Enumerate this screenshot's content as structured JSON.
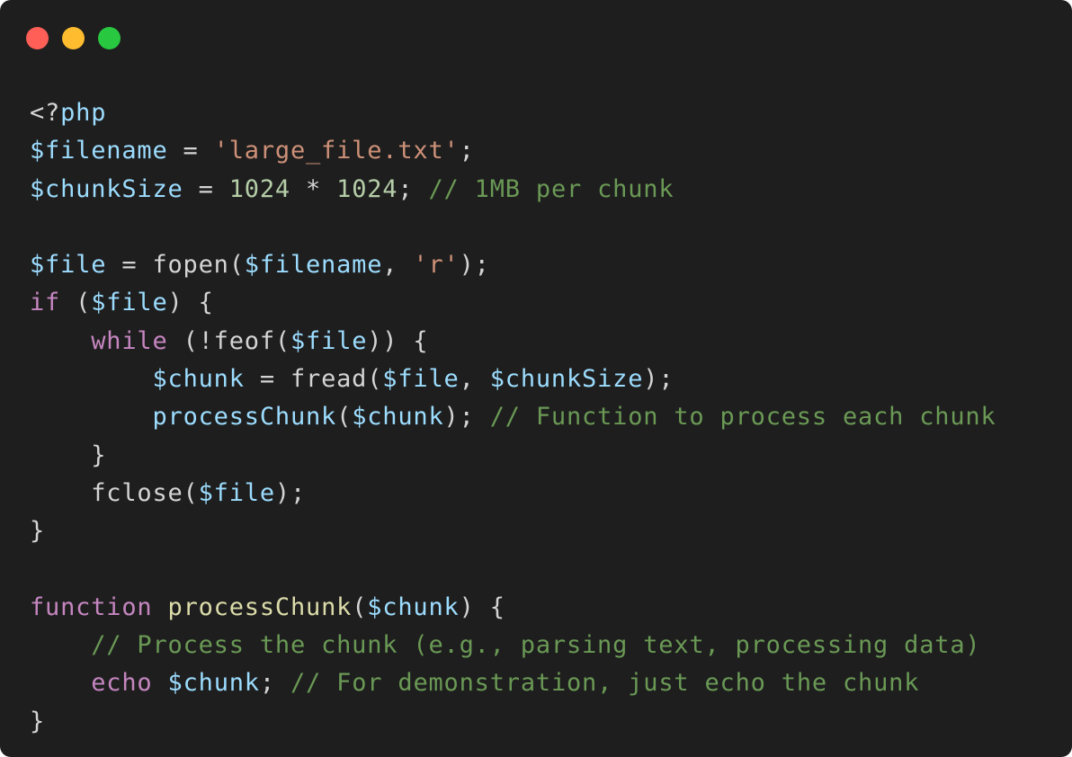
{
  "window": {
    "controls": [
      {
        "name": "close",
        "color": "#ff5f57"
      },
      {
        "name": "minimize",
        "color": "#febc2e"
      },
      {
        "name": "maximize",
        "color": "#28c840"
      }
    ]
  },
  "code": {
    "language": "php",
    "lines": [
      [
        {
          "t": "plain",
          "v": "<?"
        },
        {
          "t": "var",
          "v": "php"
        }
      ],
      [
        {
          "t": "var",
          "v": "$filename"
        },
        {
          "t": "plain",
          "v": " = "
        },
        {
          "t": "str",
          "v": "'large_file.txt'"
        },
        {
          "t": "plain",
          "v": ";"
        }
      ],
      [
        {
          "t": "var",
          "v": "$chunkSize"
        },
        {
          "t": "plain",
          "v": " = "
        },
        {
          "t": "num",
          "v": "1024"
        },
        {
          "t": "plain",
          "v": " * "
        },
        {
          "t": "num",
          "v": "1024"
        },
        {
          "t": "plain",
          "v": "; "
        },
        {
          "t": "cmt",
          "v": "// 1MB per chunk"
        }
      ],
      [],
      [
        {
          "t": "var",
          "v": "$file"
        },
        {
          "t": "plain",
          "v": " = fopen("
        },
        {
          "t": "var",
          "v": "$filename"
        },
        {
          "t": "plain",
          "v": ", "
        },
        {
          "t": "str",
          "v": "'r'"
        },
        {
          "t": "plain",
          "v": ");"
        }
      ],
      [
        {
          "t": "kw",
          "v": "if"
        },
        {
          "t": "plain",
          "v": " ("
        },
        {
          "t": "var",
          "v": "$file"
        },
        {
          "t": "plain",
          "v": ") {"
        }
      ],
      [
        {
          "t": "plain",
          "v": "    "
        },
        {
          "t": "kw",
          "v": "while"
        },
        {
          "t": "plain",
          "v": " (!feof("
        },
        {
          "t": "var",
          "v": "$file"
        },
        {
          "t": "plain",
          "v": ")) {"
        }
      ],
      [
        {
          "t": "plain",
          "v": "        "
        },
        {
          "t": "var",
          "v": "$chunk"
        },
        {
          "t": "plain",
          "v": " = fread("
        },
        {
          "t": "var",
          "v": "$file"
        },
        {
          "t": "plain",
          "v": ", "
        },
        {
          "t": "var",
          "v": "$chunkSize"
        },
        {
          "t": "plain",
          "v": ");"
        }
      ],
      [
        {
          "t": "plain",
          "v": "        "
        },
        {
          "t": "var",
          "v": "processChunk"
        },
        {
          "t": "plain",
          "v": "("
        },
        {
          "t": "var",
          "v": "$chunk"
        },
        {
          "t": "plain",
          "v": "); "
        },
        {
          "t": "cmt",
          "v": "// Function to process each chunk"
        }
      ],
      [
        {
          "t": "plain",
          "v": "    }"
        }
      ],
      [
        {
          "t": "plain",
          "v": "    fclose("
        },
        {
          "t": "var",
          "v": "$file"
        },
        {
          "t": "plain",
          "v": ");"
        }
      ],
      [
        {
          "t": "plain",
          "v": "}"
        }
      ],
      [],
      [
        {
          "t": "kw",
          "v": "function"
        },
        {
          "t": "plain",
          "v": " "
        },
        {
          "t": "fn",
          "v": "processChunk"
        },
        {
          "t": "plain",
          "v": "("
        },
        {
          "t": "var",
          "v": "$chunk"
        },
        {
          "t": "plain",
          "v": ") {"
        }
      ],
      [
        {
          "t": "plain",
          "v": "    "
        },
        {
          "t": "cmt",
          "v": "// Process the chunk (e.g., parsing text, processing data)"
        }
      ],
      [
        {
          "t": "plain",
          "v": "    "
        },
        {
          "t": "kw",
          "v": "echo"
        },
        {
          "t": "plain",
          "v": " "
        },
        {
          "t": "var",
          "v": "$chunk"
        },
        {
          "t": "plain",
          "v": "; "
        },
        {
          "t": "cmt",
          "v": "// For demonstration, just echo the chunk"
        }
      ],
      [
        {
          "t": "plain",
          "v": "}"
        }
      ]
    ]
  }
}
